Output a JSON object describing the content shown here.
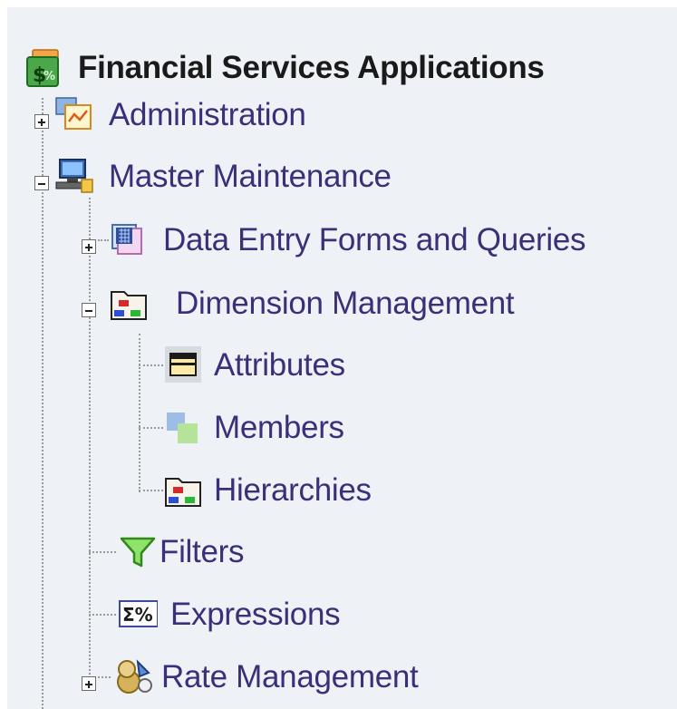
{
  "tree": {
    "root": {
      "label": "Financial Services Applications",
      "icon": "money-stack-icon"
    },
    "items": [
      {
        "label": "Administration",
        "icon": "admin-chart-icon",
        "state": "collapsed"
      },
      {
        "label": "Master Maintenance",
        "icon": "computer-network-icon",
        "state": "expanded"
      },
      {
        "label": "Data Entry Forms and Queries",
        "icon": "form-grid-icon",
        "state": "collapsed"
      },
      {
        "label": "Dimension Management",
        "icon": "folder-hierarchy-icon",
        "state": "expanded"
      },
      {
        "label": "Attributes",
        "icon": "attributes-table-icon",
        "state": "leaf"
      },
      {
        "label": "Members",
        "icon": "members-squares-icon",
        "state": "leaf"
      },
      {
        "label": "Hierarchies",
        "icon": "folder-hierarchy-icon",
        "state": "leaf"
      },
      {
        "label": "Filters",
        "icon": "funnel-icon",
        "state": "leaf"
      },
      {
        "label": "Expressions",
        "icon": "sigma-percent-icon",
        "state": "leaf"
      },
      {
        "label": "Rate Management",
        "icon": "rate-management-icon",
        "state": "collapsed"
      }
    ]
  }
}
